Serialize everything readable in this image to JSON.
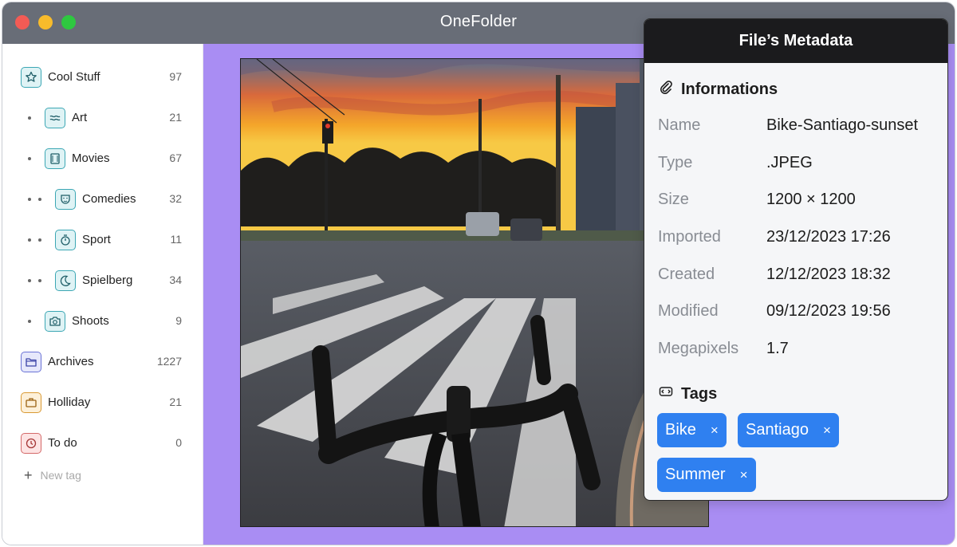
{
  "window": {
    "title": "OneFolder"
  },
  "sidebar": {
    "items": [
      {
        "label": "Cool Stuff",
        "count": "97",
        "icon": "star-icon"
      },
      {
        "label": "Art",
        "count": "21",
        "icon": "waves-icon"
      },
      {
        "label": "Movies",
        "count": "67",
        "icon": "film-icon"
      },
      {
        "label": "Comedies",
        "count": "32",
        "icon": "smile-icon"
      },
      {
        "label": "Sport",
        "count": "11",
        "icon": "stopwatch-icon"
      },
      {
        "label": "Spielberg",
        "count": "34",
        "icon": "moon-icon"
      },
      {
        "label": "Shoots",
        "count": "9",
        "icon": "camera-icon"
      },
      {
        "label": "Archives",
        "count": "1227",
        "icon": "folder-icon"
      },
      {
        "label": "Holliday",
        "count": "21",
        "icon": "briefcase-icon"
      },
      {
        "label": "To do",
        "count": "0",
        "icon": "clock-icon"
      }
    ],
    "new_tag_label": "New tag"
  },
  "metadata": {
    "header": "File’s Metadata",
    "info_title": "Informations",
    "rows": [
      {
        "key": "Name",
        "value": "Bike-Santiago-sunset"
      },
      {
        "key": "Type",
        "value": ".JPEG"
      },
      {
        "key": "Size",
        "value": "1200 × 1200"
      },
      {
        "key": "Imported",
        "value": "23/12/2023 17:26"
      },
      {
        "key": "Created",
        "value": "12/12/2023 18:32"
      },
      {
        "key": "Modified",
        "value": "09/12/2023 19:56"
      },
      {
        "key": "Megapixels",
        "value": "1.7"
      }
    ],
    "tags_title": "Tags",
    "tags": [
      "Bike",
      "Santiago",
      "Summer"
    ],
    "tag_remove_glyph": "×"
  },
  "colors": {
    "titlebar": "#686d77",
    "canvas_background": "#a98df3",
    "tag_blue": "#2f80f0"
  }
}
